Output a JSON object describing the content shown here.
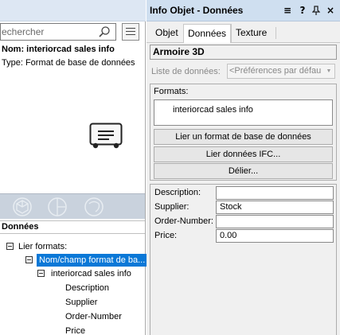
{
  "left": {
    "search": {
      "placeholder": "echercher"
    },
    "info": {
      "name": "Nom: interiorcad sales info",
      "type": "Type: Format de base de données"
    },
    "data_header": "Données",
    "tree": {
      "root": "Lier formats:",
      "selected": "Nom/champ format de ba...",
      "format": "interiorcad sales info",
      "fields": [
        "Description",
        "Supplier",
        "Order-Number",
        "Price"
      ]
    }
  },
  "panel": {
    "title": "Info Objet - Données",
    "menu_glyph": "≡",
    "help_glyph": "?",
    "pin_glyph": "ᵽ",
    "close_glyph": "×",
    "tabs": [
      "Objet",
      "Données",
      "Texture"
    ],
    "active_tab": "Données",
    "object_name": "Armoire 3D",
    "datasource_label": "Liste de données:",
    "datasource_value": "<Préférences par défau",
    "formats_label": "Formats:",
    "formats_item": "interiorcad sales info",
    "buttons": {
      "link_db_format": "Lier un format de base de données",
      "link_ifc": "Lier données IFC...",
      "unlink": "Délier..."
    },
    "attributes": [
      {
        "label": "Description:",
        "value": ""
      },
      {
        "label": "Supplier:",
        "value": "Stock"
      },
      {
        "label": "Order-Number:",
        "value": ""
      },
      {
        "label": "Price:",
        "value": "0.00"
      }
    ]
  },
  "colors": {
    "selection": "#0a78d7",
    "panel_titlebar": "#cfdff0",
    "left_titlebar": "#dde7f3",
    "view_bar": "#c9d2dd"
  }
}
